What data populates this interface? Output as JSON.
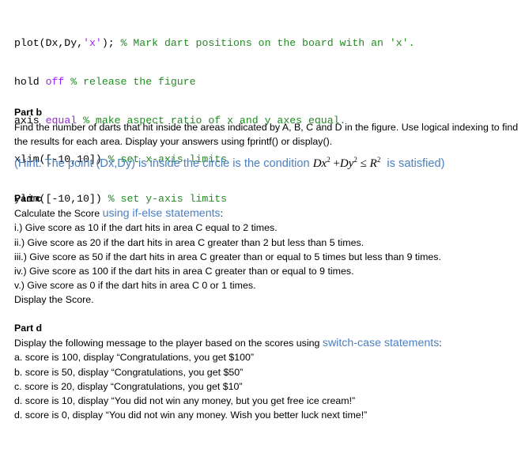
{
  "code": {
    "lines": [
      {
        "code": "plot(Dx,Dy,",
        "string": "'x'",
        "rest": "); ",
        "comment": "% Mark dart positions on the board with an 'x'."
      },
      {
        "code": "hold ",
        "keyword": "off",
        "rest": " ",
        "comment": "% release the figure"
      },
      {
        "code": "axis ",
        "keyword": "equal",
        "rest": " ",
        "comment": "% make aspect ratio of x and y axes equal."
      },
      {
        "code": "xlim([-10,10]) ",
        "comment": "% set x-axis limits"
      },
      {
        "code": "ylim([-10,10]) ",
        "comment": "% set y-axis limits"
      }
    ]
  },
  "part_b": {
    "title": "Part b",
    "text": "Find the number of darts that hit inside the areas indicated by A, B, C and D in the figure. Use logical indexing to find the results for each area. Display your answers using fprintf() or display().",
    "hint_prefix": "(Hint: The point (Dx,Dy) is inside the circle is the condition ",
    "hint_math": {
      "t1": "Dx",
      "t2": "Dy",
      "r": "R",
      "exp": "2",
      "plus": "+",
      "leq": "≤"
    },
    "hint_suffix": "  is satisfied)"
  },
  "part_c": {
    "title": "Part c",
    "intro_plain": "Calculate the Score ",
    "intro_blue": "using if-else statements",
    "intro_end": ":",
    "items": [
      "i.)  Give score as 10 if the dart hits in area C equal to 2 times.",
      "ii.) Give score as 20 if the dart hits in area C greater than 2 but less than 5 times.",
      "iii.) Give score as 50 if the dart hits in area C greater than or equal to 5 times but less than 9 times.",
      "iv.) Give score as 100 if the dart hits in area C greater than or equal to 9 times.",
      "v.) Give score as 0 if the dart hits in area C 0 or 1 times."
    ],
    "closing": "Display the Score."
  },
  "part_d": {
    "title": "Part d",
    "intro_plain": "Display the following message to the player based on the scores using ",
    "intro_blue": "switch-case statements",
    "intro_end": ":",
    "items": [
      "a. score is 100, display “Congratulations, you get $100”",
      "b. score is 50, display “Congratulations, you get $50”",
      "c. score is 20, display “Congratulations, you get $10”",
      "d. score is 10, display “You did not win any money, but you get free ice cream!”",
      "d. score is 0, display “You did not win any money. Wish you better luck next time!”"
    ]
  },
  "colors": {
    "keyword": "#a020f0",
    "comment": "#228b22",
    "accent_blue": "#4a7fc1"
  }
}
